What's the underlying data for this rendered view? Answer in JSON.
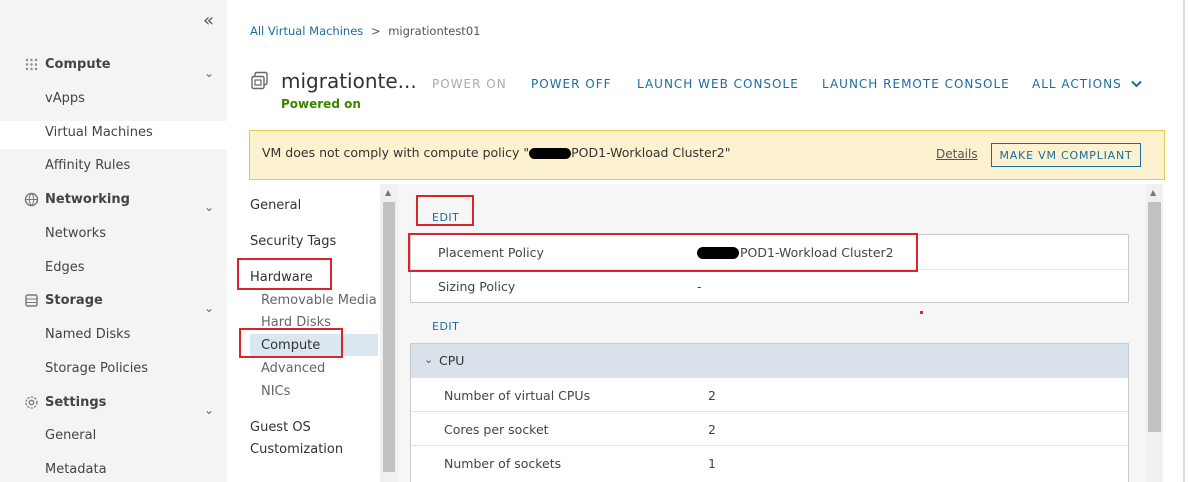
{
  "sidebar": {
    "collapse_icon": "double-chevron-left-icon",
    "groups": [
      {
        "label": "Compute",
        "icon": "grid-icon",
        "items": [
          "vApps",
          "Virtual Machines",
          "Affinity Rules"
        ]
      },
      {
        "label": "Networking",
        "icon": "globe-icon",
        "items": [
          "Networks",
          "Edges"
        ]
      },
      {
        "label": "Storage",
        "icon": "storage-icon",
        "items": [
          "Named Disks",
          "Storage Policies"
        ]
      },
      {
        "label": "Settings",
        "icon": "gear-icon",
        "items": [
          "General",
          "Metadata"
        ]
      }
    ],
    "active_item": "Virtual Machines"
  },
  "breadcrumb": {
    "root": "All Virtual Machines",
    "separator": ">",
    "current": "migrationtest01"
  },
  "vm": {
    "name": "migrationte...",
    "status": "Powered on",
    "status_color": "#3c8500"
  },
  "actions": {
    "power_on": "POWER ON",
    "power_off": "POWER OFF",
    "launch_web_console": "LAUNCH WEB CONSOLE",
    "launch_remote_console": "LAUNCH REMOTE CONSOLE",
    "all_actions": "ALL ACTIONS"
  },
  "alert": {
    "text_prefix": "VM does not comply with compute policy \"",
    "text_suffix": "POD1-Workload Cluster2\"",
    "details": "Details",
    "button": "MAKE VM COMPLIANT",
    "bg_color": "#fcf2d0"
  },
  "inner_nav": {
    "general": "General",
    "security_tags": "Security Tags",
    "hardware": "Hardware",
    "hardware_items": [
      "Removable Media",
      "Hard Disks",
      "Compute",
      "Advanced",
      "NICs"
    ],
    "guest_os_line1": "Guest OS",
    "guest_os_line2": "Customization"
  },
  "policies": {
    "edit_label": "EDIT",
    "rows": [
      {
        "key": "Placement Policy",
        "value": "POD1-Workload Cluster2"
      },
      {
        "key": "Sizing Policy",
        "value": "-"
      }
    ]
  },
  "cpu": {
    "edit_label": "EDIT",
    "title": "CPU",
    "rows": [
      {
        "key": "Number of virtual CPUs",
        "value": "2"
      },
      {
        "key": "Cores per socket",
        "value": "2"
      },
      {
        "key": "Number of sockets",
        "value": "1"
      }
    ]
  },
  "colors": {
    "accent": "#1b6c9e",
    "annotation_red": "#d9252a"
  }
}
